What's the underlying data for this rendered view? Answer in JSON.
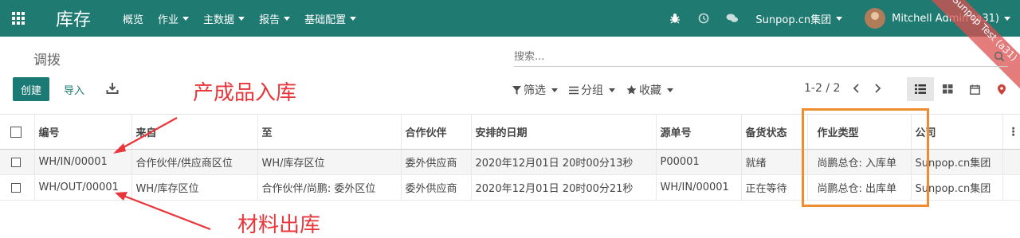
{
  "app": {
    "name": "库存",
    "menu": [
      "概览",
      "作业",
      "主数据",
      "报告",
      "基础配置"
    ],
    "menu_has_caret": [
      false,
      true,
      true,
      true,
      true
    ],
    "company": "Sunpop.cn集团",
    "user": "Mitchell Admin (a31)",
    "ribbon": "Sunpop Test (a31)"
  },
  "control": {
    "breadcrumb": "调拨",
    "search_placeholder": "搜索...",
    "create_label": "创建",
    "import_label": "导入",
    "filter_label": "筛选",
    "group_label": "分组",
    "favorite_label": "收藏",
    "pager": "1-2 / 2"
  },
  "annotations": {
    "top": "产成品入库",
    "bottom": "材料出库",
    "color": "#e8363a",
    "highlight_color": "#f08c30"
  },
  "table": {
    "columns": [
      "编号",
      "来自",
      "至",
      "合作伙伴",
      "安排的日期",
      "源单号",
      "备货状态",
      "作业类型",
      "公司"
    ],
    "rows": [
      [
        "WH/IN/00001",
        "合作伙伴/供应商区位",
        "WH/库存区位",
        "委外供应商",
        "2020年12月01日 20时00分13秒",
        "P00001",
        "就绪",
        "尚鹏总仓: 入库单",
        "Sunpop.cn集团"
      ],
      [
        "WH/OUT/00001",
        "WH/库存区位",
        "合作伙伴/尚鹏: 委外区位",
        "委外供应商",
        "2020年12月01日 20时00分21秒",
        "WH/IN/00001",
        "正在等待",
        "尚鹏总仓: 出库单",
        "Sunpop.cn集团"
      ]
    ]
  },
  "colors": {
    "navbar": "#1f7a72",
    "primary": "#1c7a74"
  }
}
